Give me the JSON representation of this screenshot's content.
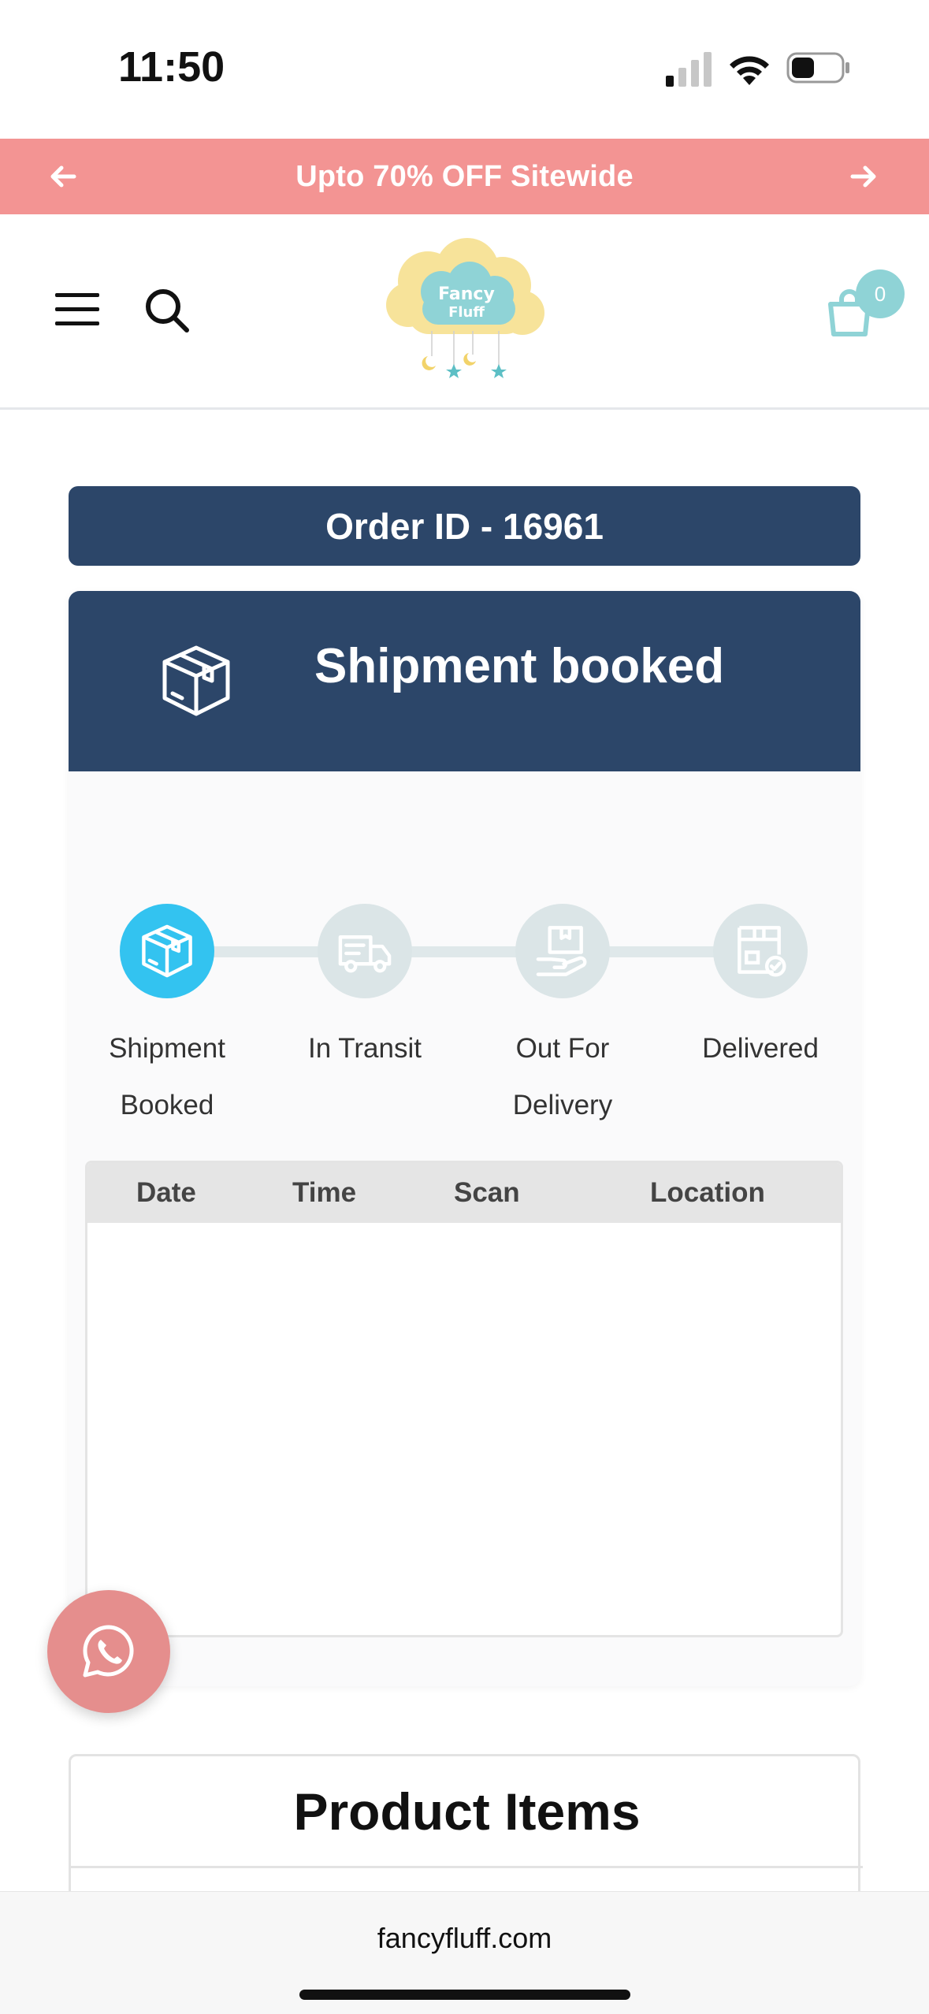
{
  "status_bar": {
    "time": "11:50"
  },
  "promo": {
    "text": "Upto 70% OFF Sitewide",
    "prev_icon": "arrow-left-icon",
    "next_icon": "arrow-right-icon"
  },
  "header": {
    "menu_icon": "hamburger-menu-icon",
    "search_icon": "search-icon",
    "logo_text_1": "Fancy",
    "logo_text_2": "Fluff",
    "cart_icon": "shopping-bag-icon",
    "cart_count": "0"
  },
  "order": {
    "id_label": "Order ID - 16961"
  },
  "tracking": {
    "status_title": "Shipment booked",
    "status_icon": "box-icon",
    "steps": [
      {
        "line1": "Shipment",
        "line2": "Booked",
        "active": true,
        "icon": "box-icon"
      },
      {
        "line1": "In Transit",
        "line2": "",
        "active": false,
        "icon": "truck-icon"
      },
      {
        "line1": "Out For",
        "line2": "Delivery",
        "active": false,
        "icon": "hand-package-icon"
      },
      {
        "line1": "Delivered",
        "line2": "",
        "active": false,
        "icon": "delivered-check-icon"
      }
    ],
    "table_headers": [
      "Date",
      "Time",
      "Scan",
      "Location"
    ]
  },
  "fab": {
    "icon": "whatsapp-icon"
  },
  "products": {
    "title": "Product Items"
  },
  "browser": {
    "url": "fancyfluff.com"
  },
  "colors": {
    "promo_bg": "#f39493",
    "navy": "#2c4669",
    "active_step": "#33c3f0",
    "inactive_step": "#dbe5e7",
    "fab": "#e58e8d",
    "logo_teal": "#8fd3d6",
    "logo_yellow": "#f7e39a"
  }
}
